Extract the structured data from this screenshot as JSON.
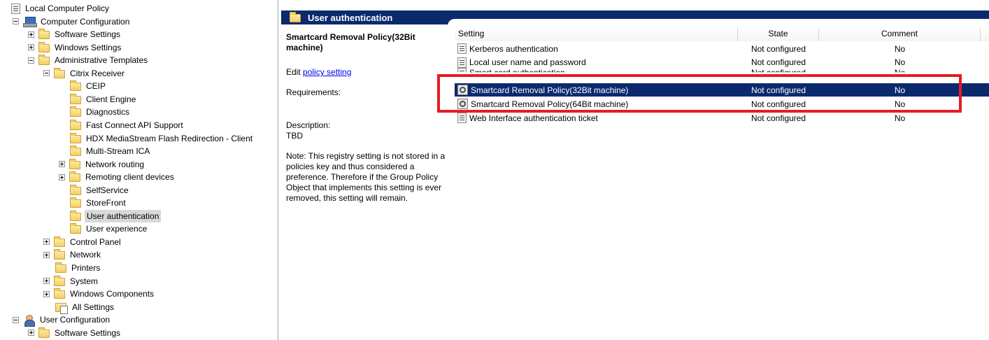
{
  "tree": {
    "items": [
      {
        "label": "Local Computer Policy",
        "icon": "policy-icon"
      },
      {
        "label": "Computer Configuration",
        "icon": "computer-icon",
        "expander": "minus"
      },
      {
        "label": "Software Settings",
        "icon": "folder-icon",
        "expander": "plus"
      },
      {
        "label": "Windows Settings",
        "icon": "folder-icon",
        "expander": "plus"
      },
      {
        "label": "Administrative Templates",
        "icon": "folder-icon",
        "expander": "minus"
      },
      {
        "label": "Citrix Receiver",
        "icon": "folder-icon",
        "expander": "minus"
      },
      {
        "label": "CEIP",
        "icon": "folder-icon"
      },
      {
        "label": "Client Engine",
        "icon": "folder-icon"
      },
      {
        "label": "Diagnostics",
        "icon": "folder-icon"
      },
      {
        "label": "Fast Connect API Support",
        "icon": "folder-icon"
      },
      {
        "label": "HDX MediaStream Flash Redirection - Client",
        "icon": "folder-icon"
      },
      {
        "label": "Multi-Stream ICA",
        "icon": "folder-icon"
      },
      {
        "label": "Network routing",
        "icon": "folder-icon",
        "expander": "plus"
      },
      {
        "label": "Remoting client devices",
        "icon": "folder-icon",
        "expander": "plus"
      },
      {
        "label": "SelfService",
        "icon": "folder-icon"
      },
      {
        "label": "StoreFront",
        "icon": "folder-icon"
      },
      {
        "label": "User authentication",
        "icon": "folder-icon",
        "selected": true
      },
      {
        "label": "User experience",
        "icon": "folder-icon"
      },
      {
        "label": "Control Panel",
        "icon": "folder-icon",
        "expander": "plus"
      },
      {
        "label": "Network",
        "icon": "folder-icon",
        "expander": "plus"
      },
      {
        "label": "Printers",
        "icon": "folder-icon"
      },
      {
        "label": "System",
        "icon": "folder-icon",
        "expander": "plus"
      },
      {
        "label": "Windows Components",
        "icon": "folder-icon",
        "expander": "plus"
      },
      {
        "label": "All Settings",
        "icon": "all-settings-icon"
      },
      {
        "label": "User Configuration",
        "icon": "user-icon",
        "expander": "minus"
      },
      {
        "label": "Software Settings",
        "icon": "folder-icon",
        "expander": "plus"
      }
    ]
  },
  "header": {
    "title": "User authentication"
  },
  "description": {
    "title": "Smartcard Removal Policy(32Bit machine)",
    "edit_prefix": "Edit ",
    "edit_link": "policy setting ",
    "requirements_label": "Requirements:",
    "description_label": "Description:",
    "description_text": "TBD",
    "note": "Note:  This registry setting is not stored in a policies key and thus considered a preference.  Therefore if the Group Policy Object that implements this setting is ever removed, this setting will remain."
  },
  "list": {
    "columns": {
      "setting": "Setting",
      "state": "State",
      "comment": "Comment"
    },
    "rows": [
      {
        "setting": "Kerberos authentication",
        "state": "Not configured",
        "comment": "No",
        "icon": "policy-icon"
      },
      {
        "setting": "Local user name and password",
        "state": "Not configured",
        "comment": "No",
        "icon": "policy-icon"
      },
      {
        "setting": "Smart card authentication",
        "state": "Not configured",
        "comment": "No",
        "icon": "policy-icon",
        "obscured": true
      },
      {
        "setting": "Smartcard Removal Policy(32Bit machine)",
        "state": "Not configured",
        "comment": "No",
        "icon": "gear-icon",
        "selected": true
      },
      {
        "setting": "Smartcard Removal Policy(64Bit machine)",
        "state": "Not configured",
        "comment": "No",
        "icon": "gear-icon"
      },
      {
        "setting": "Web Interface authentication ticket",
        "state": "Not configured",
        "comment": "No",
        "icon": "policy-icon"
      }
    ]
  },
  "colors": {
    "selection": "#0b2a6d",
    "highlight_box": "#e51c23"
  }
}
